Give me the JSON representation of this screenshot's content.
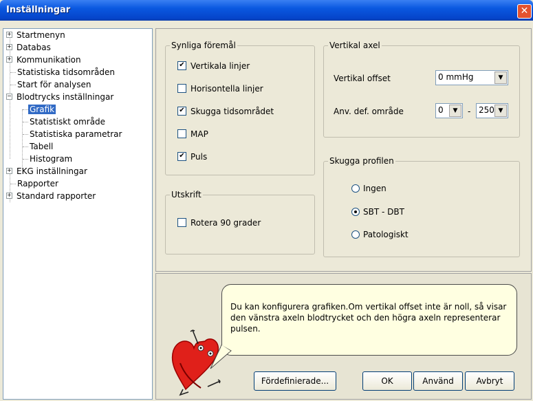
{
  "window": {
    "title": "Inställningar",
    "close_glyph": "✕"
  },
  "tree": {
    "items": [
      {
        "label": "Startmenyn",
        "expander": "+"
      },
      {
        "label": "Databas",
        "expander": "+"
      },
      {
        "label": "Kommunikation",
        "expander": "+"
      },
      {
        "label": "Statistiska tidsområden",
        "expander": ""
      },
      {
        "label": "Start för analysen",
        "expander": ""
      },
      {
        "label": "Blodtrycks inställningar",
        "expander": "−"
      },
      {
        "label": "Grafik",
        "expander": "",
        "selected": true
      },
      {
        "label": "Statistiskt område",
        "expander": ""
      },
      {
        "label": "Statistiska parametrar",
        "expander": ""
      },
      {
        "label": "Tabell",
        "expander": ""
      },
      {
        "label": "Histogram",
        "expander": ""
      },
      {
        "label": "EKG inställningar",
        "expander": "+"
      },
      {
        "label": "Rapporter",
        "expander": ""
      },
      {
        "label": "Standard rapporter",
        "expander": "+"
      }
    ]
  },
  "visible_items": {
    "title": "Synliga föremål",
    "checkboxes": [
      {
        "label": "Vertikala linjer",
        "checked": true
      },
      {
        "label": "Horisontella linjer",
        "checked": false
      },
      {
        "label": "Skugga tidsområdet",
        "checked": true
      },
      {
        "label": "MAP",
        "checked": false
      },
      {
        "label": "Puls",
        "checked": true
      }
    ]
  },
  "vertical_axis": {
    "title": "Vertikal axel",
    "offset_label": "Vertikal offset",
    "offset_value": "0 mmHg",
    "range_label": "Anv. def. område",
    "range_from": "0",
    "range_sep": "-",
    "range_to": "250"
  },
  "print": {
    "title": "Utskrift",
    "rotate_label": "Rotera 90 grader",
    "rotate_checked": false
  },
  "shade_profile": {
    "title": "Skugga profilen",
    "options": [
      {
        "label": "Ingen",
        "selected": false
      },
      {
        "label": "SBT - DBT",
        "selected": true
      },
      {
        "label": "Patologiskt",
        "selected": false
      }
    ]
  },
  "help": {
    "text": "Du kan konfigurera grafiken.Om vertikal offset inte är noll, så visar den vänstra axeln blodtrycket och den högra axeln representerar pulsen."
  },
  "buttons": {
    "predefined": "Fördefinierade...",
    "ok": "OK",
    "apply": "Använd",
    "cancel": "Avbryt"
  },
  "colors": {
    "title_bar": "#0a58e0",
    "selection": "#316ac5",
    "bubble": "#ffffe1",
    "mascot": "#e0201a"
  },
  "icons": {
    "checkmark": "✔",
    "dropdown": "▼"
  }
}
